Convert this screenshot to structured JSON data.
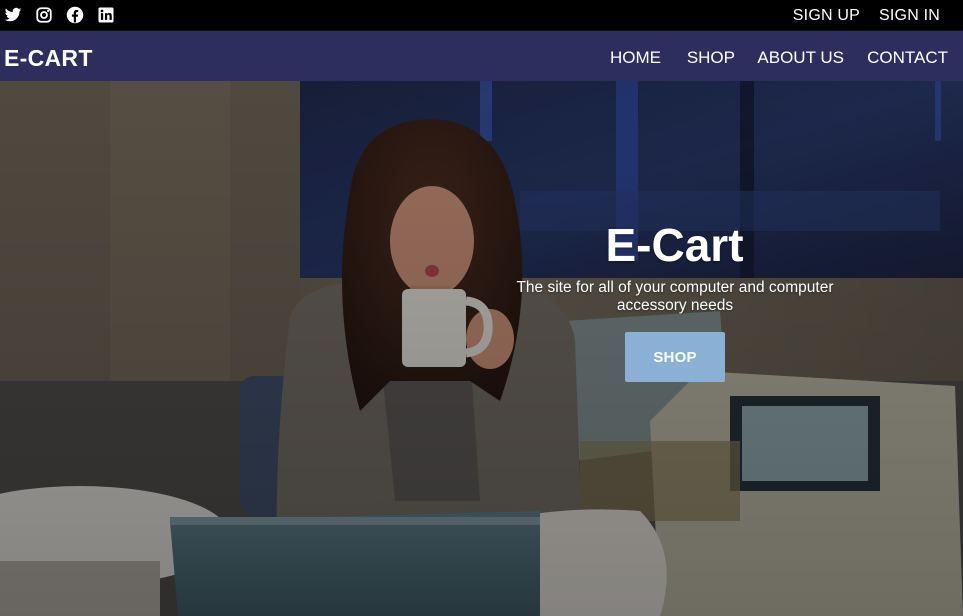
{
  "topbar": {
    "social_icons": [
      "twitter-icon",
      "instagram-icon",
      "facebook-icon",
      "linkedin-icon"
    ],
    "sign_up": "SIGN UP",
    "sign_in": "SIGN IN"
  },
  "navbar": {
    "brand": "E-CART",
    "links": [
      "HOME",
      "SHOP",
      "ABOUT US",
      "CONTACT"
    ]
  },
  "hero": {
    "title": "E-Cart",
    "subtitle": "The site for all of your computer and computer accessory needs",
    "button_label": "SHOP"
  },
  "colors": {
    "topbar_bg": "#000000",
    "navbar_bg": "#2e2e5e",
    "button_bg": "#8ab0d6",
    "text": "#ffffff"
  }
}
